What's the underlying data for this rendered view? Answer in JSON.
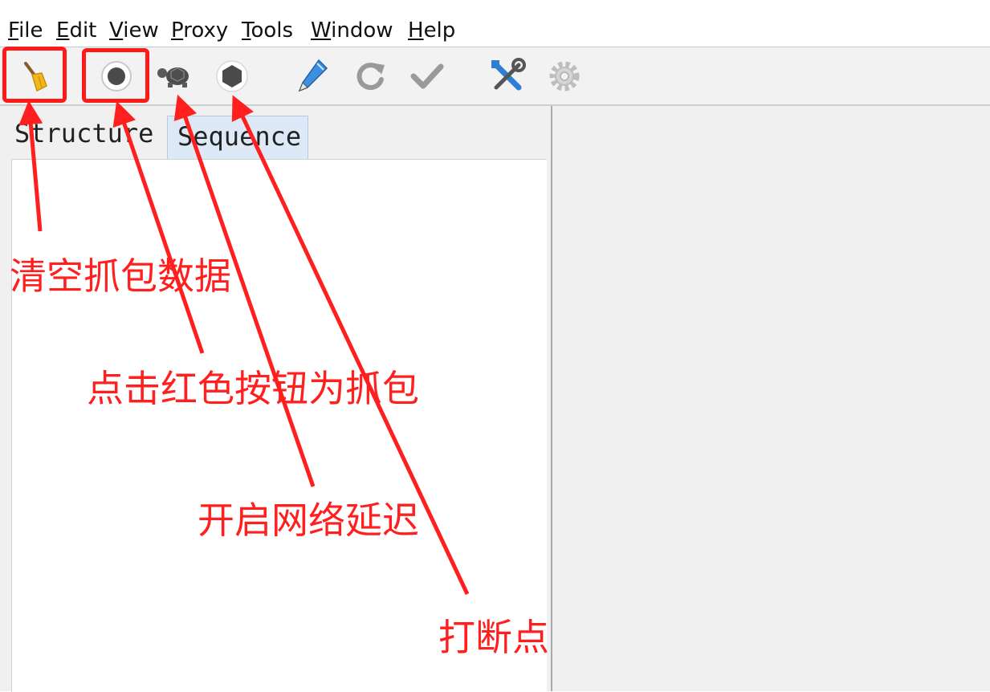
{
  "menu": {
    "file": {
      "u": "F",
      "rest": "ile"
    },
    "edit": {
      "u": "E",
      "rest": "dit"
    },
    "view": {
      "u": "V",
      "rest": "iew"
    },
    "proxy": {
      "u": "P",
      "rest": "roxy"
    },
    "tools": {
      "u": "T",
      "rest": "ools"
    },
    "window": {
      "u": "W",
      "rest": "indow"
    },
    "help": {
      "u": "H",
      "rest": "elp"
    }
  },
  "toolbar": {
    "icons": [
      "broom-icon",
      "record-icon",
      "turtle-icon",
      "breakpoint-icon",
      "pen-icon",
      "refresh-icon",
      "check-icon",
      "tools-icon",
      "gear-icon"
    ]
  },
  "tabs": {
    "structure": "Structure",
    "sequence": "Sequence"
  },
  "annotations": {
    "clear": "清空抓包数据",
    "record": "点击红色按钮为抓包",
    "throttle": "开启网络延迟",
    "breakpoint": "打断点"
  },
  "colors": {
    "annotation_red": "#ff1f1f",
    "tab_selected_bg": "#dde9f7"
  }
}
